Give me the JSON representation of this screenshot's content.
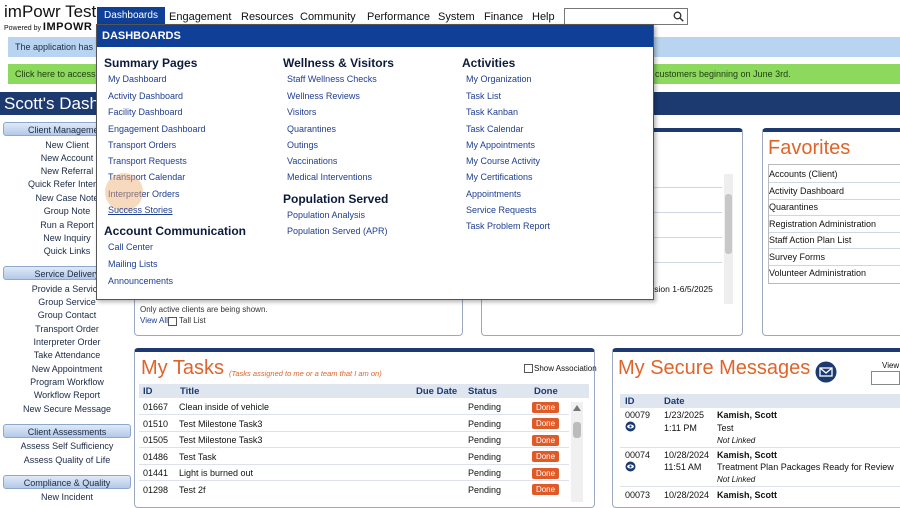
{
  "app": {
    "logo_text": "imPowr Test",
    "powered_prefix": "Powered by",
    "powered_brand": "IMPOWR"
  },
  "nav": [
    "Dashboards",
    "Engagement",
    "Resources",
    "Community",
    "Performance",
    "System",
    "Finance",
    "Help"
  ],
  "search": {
    "placeholder": ""
  },
  "banners": {
    "info": "The application has b",
    "green_left": "Click here to access t",
    "green_right": "customers beginning on June 3rd."
  },
  "page_title": "Scott's Dashb",
  "sidebar": {
    "client_management": {
      "title": "Client Management",
      "items": [
        "New Client",
        "New Account",
        "New Referral",
        "Quick Refer Interna",
        "New Case Note",
        "Group Note",
        "Run a Report",
        "New Inquiry",
        "Quick Links"
      ]
    },
    "service_delivery": {
      "title": "Service Delivery",
      "items": [
        "Provide a Service",
        "Group Service",
        "Group Contact",
        "Transport Order",
        "Interpreter Order",
        "Take Attendance",
        "New Appointment",
        "Program Workflow",
        "Workflow Report",
        "New Secure Message"
      ]
    },
    "client_assessments": {
      "title": "Client Assessments",
      "items": [
        "Assess Self Sufficiency",
        "Assess Quality of Life"
      ]
    },
    "compliance": {
      "title": "Compliance & Quality",
      "items": [
        "New Incident"
      ]
    }
  },
  "dropdown": {
    "title": "DASHBOARDS",
    "summary": {
      "heading": "Summary Pages",
      "items": [
        "My Dashboard",
        "Activity Dashboard",
        "Facility Dashboard",
        "Engagement Dashboard",
        "Transport Orders",
        "Transport Requests",
        "Transport Calendar",
        "Interpreter Orders",
        "Success Stories"
      ]
    },
    "account": {
      "heading": "Account Communication",
      "items": [
        "Call Center",
        "Mailing Lists",
        "Announcements"
      ]
    },
    "wellness": {
      "heading": "Wellness & Visitors",
      "items": [
        "Staff Wellness Checks",
        "Wellness Reviews",
        "Visitors",
        "Quarantines",
        "Outings",
        "Vaccinations",
        "Medical Interventions"
      ]
    },
    "population": {
      "heading": "Population Served",
      "items": [
        "Population Analysis",
        "Population Served (APR)"
      ]
    },
    "activities": {
      "heading": "Activities",
      "items": [
        "My Organization",
        "Task List",
        "Task Kanban",
        "Task Calendar",
        "My Appointments",
        "My Course Activity",
        "My Certifications",
        "Appointments",
        "Service Requests",
        "Task Problem Report"
      ]
    }
  },
  "clients_panel": {
    "note": "Only active clients are being shown.",
    "view_all": "View All",
    "tall_list": "Tall List"
  },
  "middle_panel": {
    "visible_text": "ssion 1-6/5/2025"
  },
  "favorites": {
    "title": "Favorites",
    "items": [
      "Accounts (Client)",
      "Activity Dashboard",
      "Quarantines",
      "Registration Administration",
      "Staff Action Plan List",
      "Survey Forms",
      "Volunteer Administration"
    ]
  },
  "tasks": {
    "title": "My Tasks",
    "subtitle": "(Tasks assigned to me or a team that I am on)",
    "show_association": "Show Association",
    "columns": [
      "ID",
      "Title",
      "Due Date",
      "Status",
      "Done"
    ],
    "rows": [
      {
        "id": "01667",
        "title": "Clean inside of vehicle",
        "due": "",
        "status": "Pending",
        "done": "Done"
      },
      {
        "id": "01510",
        "title": "Test Milestone Task3",
        "due": "",
        "status": "Pending",
        "done": "Done"
      },
      {
        "id": "01505",
        "title": "Test Milestone Task3",
        "due": "",
        "status": "Pending",
        "done": "Done"
      },
      {
        "id": "01486",
        "title": "Test Task",
        "due": "",
        "status": "Pending",
        "done": "Done"
      },
      {
        "id": "01441",
        "title": "Light is burned out",
        "due": "",
        "status": "Pending",
        "done": "Done"
      },
      {
        "id": "01298",
        "title": "Test 2f",
        "due": "",
        "status": "Pending",
        "done": "Done"
      }
    ]
  },
  "messages": {
    "title": "My Secure Messages",
    "view_label": "View:",
    "columns": [
      "ID",
      "Date"
    ],
    "rows": [
      {
        "id": "00079",
        "date": "1/23/2025",
        "time": "1:11 PM",
        "from": "Kamish, Scott",
        "subject": "Test",
        "link": "Not Linked"
      },
      {
        "id": "00074",
        "date": "10/28/2024",
        "time": "11:51 AM",
        "from": "Kamish, Scott",
        "subject": "Treatment Plan Packages Ready for Review",
        "link": "Not Linked"
      },
      {
        "id": "00073",
        "date": "10/28/2024",
        "time": "",
        "from": "Kamish, Scott",
        "subject": "",
        "link": ""
      }
    ]
  },
  "colors": {
    "nav_active": "#0f3f96",
    "title_bar": "#1c3a70",
    "green_banner": "#8cd95e",
    "info_banner": "#b9d4f0",
    "accent_orange": "#e0642a",
    "done_button": "#e05a28"
  }
}
